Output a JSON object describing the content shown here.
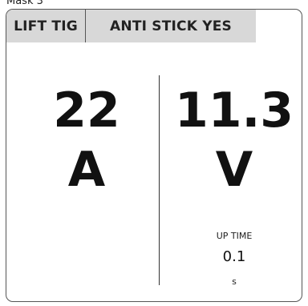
{
  "caption": "Mask 3",
  "status_bar": {
    "mode_label": "LIFT TIG",
    "anti_stick_label": "ANTI STICK YES"
  },
  "current": {
    "value": "22",
    "unit": "A"
  },
  "voltage": {
    "value": "11.3",
    "unit": "V"
  },
  "parameter": {
    "label": "UP TIME",
    "value": "0.1",
    "unit": "s"
  }
}
